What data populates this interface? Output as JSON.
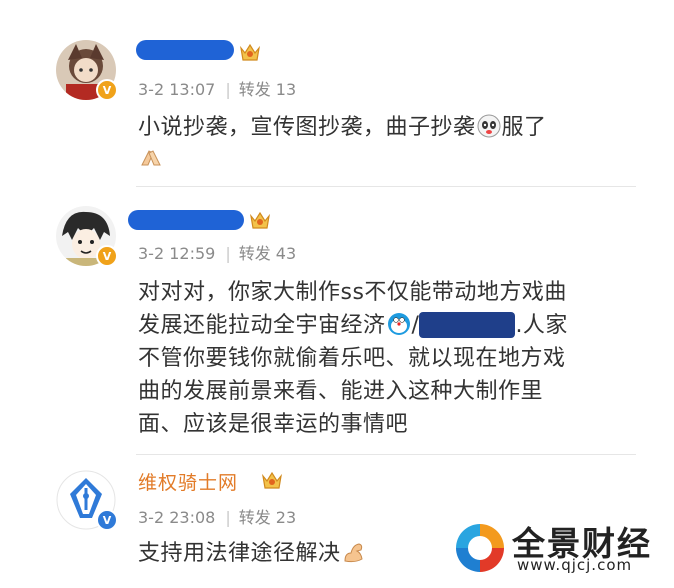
{
  "posts": [
    {
      "username": "",
      "username_redacted": true,
      "verified_color": "#f0a21a",
      "date": "3-2 13:07",
      "repost_label": "转发 13",
      "text_lines": [
        "小说抄袭，宣传图抄袭，曲子抄袭",
        "服了"
      ],
      "emojis": [
        "panda-emoji",
        "clap-hands-emoji"
      ]
    },
    {
      "username": "",
      "username_redacted": true,
      "verified_color": "#f0a21a",
      "date": "3-2 12:59",
      "repost_label": "转发 43",
      "text_line1": "对对对，你家大制作ss不仅能带动地方戏曲",
      "text_line2a": "发展还能拉动全宇宙经济",
      "text_line2b": "/",
      "text_line2c": ".人家",
      "text_line3": "不管你要钱你就偷着乐吧、就以现在地方戏",
      "text_line4": "曲的发展前景来看、能进入这种大制作里",
      "text_line5": "面、应该是很幸运的事情吧",
      "emojis": [
        "doraemon-emoji"
      ]
    },
    {
      "username": "维权骑士网",
      "username_redacted": false,
      "verified_color": "#2f7ad8",
      "date": "3-2 23:08",
      "repost_label": "转发 23",
      "text": "支持用法律途径解决",
      "emojis": [
        "strong-arm-emoji"
      ]
    }
  ],
  "watermark": {
    "name": "全景财经",
    "url": "www.qjcj.com"
  },
  "colors": {
    "username": "#e27b28",
    "meta": "#8a8a8a",
    "text": "#333333",
    "redaction": "#1f63d6"
  }
}
